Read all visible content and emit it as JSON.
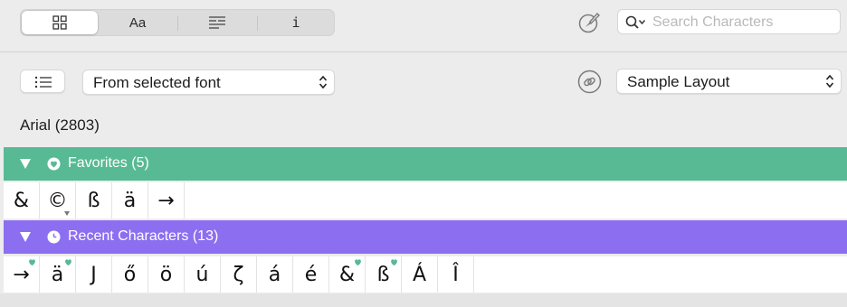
{
  "toolbar": {
    "segments": [
      {
        "name": "grid-view",
        "label": "",
        "icon": "grid-icon"
      },
      {
        "name": "font-view",
        "label": "Aa",
        "icon": ""
      },
      {
        "name": "list-view",
        "label": "",
        "icon": "text-lines-icon"
      },
      {
        "name": "info-view",
        "label": "i",
        "icon": ""
      }
    ],
    "active_segment": "grid-view",
    "search": {
      "placeholder": "Search Characters",
      "value": ""
    }
  },
  "filter_bar": {
    "font_source": "From selected font",
    "layout": "Sample Layout"
  },
  "font": {
    "title": "Arial (2803)"
  },
  "sections": [
    {
      "name": "favorites",
      "label": "Favorites (5)",
      "icon": "heart-icon",
      "color": "#58ba94",
      "chars": [
        {
          "char": "&",
          "favorite": false,
          "has_variants": false
        },
        {
          "char": "©",
          "favorite": false,
          "has_variants": true
        },
        {
          "char": "ß",
          "favorite": false,
          "has_variants": false
        },
        {
          "char": "ä",
          "favorite": false,
          "has_variants": false
        },
        {
          "char": "→",
          "favorite": false,
          "has_variants": false
        }
      ]
    },
    {
      "name": "recent",
      "label": "Recent Characters (13)",
      "icon": "clock-icon",
      "color": "#8c6ef0",
      "chars": [
        {
          "char": "→",
          "favorite": true
        },
        {
          "char": "ä",
          "favorite": true
        },
        {
          "char": "J",
          "favorite": false
        },
        {
          "char": "ő",
          "favorite": false
        },
        {
          "char": "ö",
          "favorite": false
        },
        {
          "char": "ú",
          "favorite": false
        },
        {
          "char": "ζ",
          "favorite": false
        },
        {
          "char": "á",
          "favorite": false
        },
        {
          "char": "é",
          "favorite": false
        },
        {
          "char": "&",
          "favorite": true
        },
        {
          "char": "ß",
          "favorite": true
        },
        {
          "char": "Á",
          "favorite": false
        },
        {
          "char": "Î",
          "favorite": false
        }
      ]
    }
  ],
  "colors": {
    "favorites_header": "#58ba94",
    "recent_header": "#8c6ef0",
    "heart_badge": "#58ba94"
  }
}
